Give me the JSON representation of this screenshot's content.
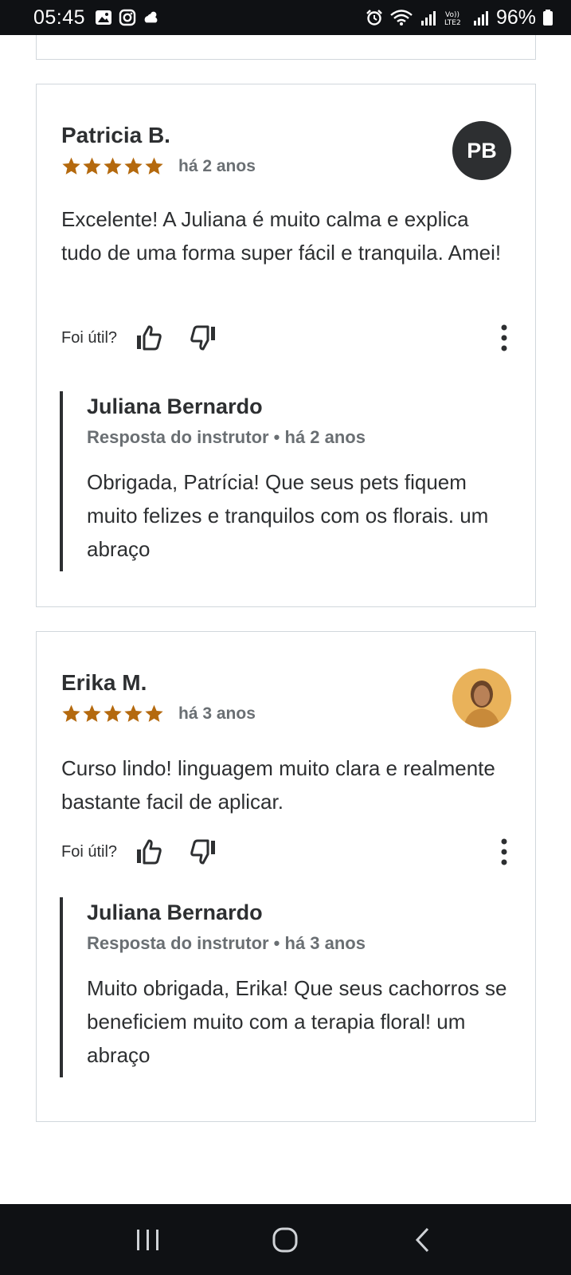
{
  "status_bar": {
    "time": "05:45",
    "battery": "96%",
    "icons": [
      "gallery-icon",
      "instagram-icon",
      "weather-icon",
      "alarm-icon",
      "wifi-icon",
      "signal-icon",
      "volte-icon",
      "signal-icon",
      "battery-icon"
    ]
  },
  "reviews": [
    {
      "name": "Patricia B.",
      "rating": 5,
      "time": "há 2 anos",
      "avatar_initials": "PB",
      "text": "Excelente! A Juliana é muito calma e explica tudo de uma forma super fácil e tranquila. Amei!",
      "helpful_label": "Foi útil?",
      "reply": {
        "name": "Juliana Bernardo",
        "meta": "Resposta do instrutor • há 2 anos",
        "text": "Obrigada, Patrícia! Que seus pets fiquem muito felizes e tranquilos com os florais. um abraço"
      }
    },
    {
      "name": "Erika M.",
      "rating": 5,
      "time": "há 3 anos",
      "avatar_initials": "",
      "text": "Curso lindo! linguagem muito clara e realmente bastante facil de aplicar.",
      "helpful_label": "Foi útil?",
      "reply": {
        "name": "Juliana Bernardo",
        "meta": "Resposta do instrutor • há 3 anos",
        "text": "Muito obrigada, Erika! Que seus cachorros se beneficiem muito com a terapia floral! um abraço"
      }
    }
  ],
  "colors": {
    "star": "#b4690e",
    "text": "#2d2f31",
    "muted": "#6a6f73",
    "border": "#d1d7dc",
    "system_bar": "#0f1114"
  },
  "nav_bar": {
    "buttons": [
      "recent-apps-icon",
      "home-icon",
      "back-icon"
    ]
  }
}
